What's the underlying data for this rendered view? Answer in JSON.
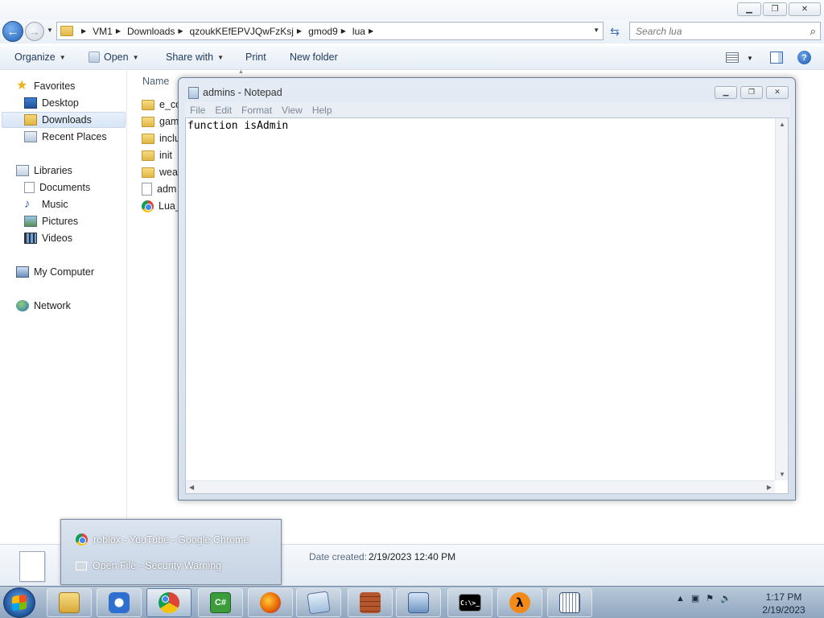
{
  "explorer": {
    "window_controls": {
      "minimize": "▁",
      "maximize": "❐",
      "close": "✕"
    },
    "breadcrumb": [
      "VM1",
      "Downloads",
      "qzoukKEfEPVJQwFzKsj",
      "gmod9",
      "lua"
    ],
    "search_placeholder": "Search lua",
    "toolbar": {
      "organize": "Organize",
      "open": "Open",
      "share_with": "Share with",
      "print": "Print",
      "new_folder": "New folder"
    },
    "nav": {
      "favorites": "Favorites",
      "desktop": "Desktop",
      "downloads": "Downloads",
      "recent_places": "Recent Places",
      "libraries": "Libraries",
      "documents": "Documents",
      "music": "Music",
      "pictures": "Pictures",
      "videos": "Videos",
      "my_computer": "My Computer",
      "network": "Network"
    },
    "column_name": "Name",
    "files": [
      "e_co",
      "gam",
      "inclu",
      "init",
      "weap",
      "adm",
      "Lua_"
    ],
    "details": {
      "date_created_label": "Date created:",
      "date_created_value": "2/19/2023 12:40 PM"
    }
  },
  "notepad": {
    "title": "admins - Notepad",
    "menu": [
      "File",
      "Edit",
      "Format",
      "View",
      "Help"
    ],
    "content": "function isAdmin",
    "controls": {
      "minimize": "▁",
      "maximize": "❐",
      "close": "✕"
    }
  },
  "popup": {
    "items": [
      "roblox - YouTube - Google Chrome",
      "Open File - Security Warning"
    ]
  },
  "taskbar": {
    "apps": [
      "explorer",
      "media-player",
      "chrome",
      "csharp",
      "firefox",
      "notepad",
      "firewall",
      "control-panel",
      "cmd",
      "half-life-2",
      "keyboard"
    ],
    "cmd_label": "C:\\>_",
    "csharp_label": "C#",
    "time": "1:17 PM",
    "date": "2/19/2023"
  },
  "colors": {
    "accent": "#1f5fb8",
    "taskbar": "#a9bccf"
  }
}
